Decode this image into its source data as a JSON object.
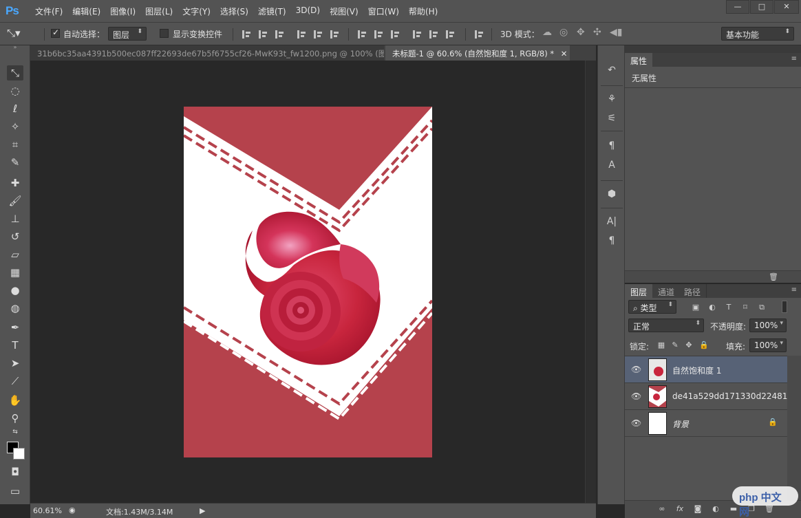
{
  "app": {
    "logo": "Ps"
  },
  "menu": [
    "文件(F)",
    "编辑(E)",
    "图像(I)",
    "图层(L)",
    "文字(Y)",
    "选择(S)",
    "滤镜(T)",
    "3D(D)",
    "视图(V)",
    "窗口(W)",
    "帮助(H)"
  ],
  "window_controls": {
    "minimize": "—",
    "maximize": "□",
    "close": "✕"
  },
  "options_bar": {
    "auto_select_label": "自动选择：",
    "auto_select_checked": true,
    "auto_select_target": "图层",
    "show_transform_label": "显示变换控件",
    "show_transform_checked": false,
    "mode_3d_label": "3D 模式：",
    "workspace": "基本功能"
  },
  "tabs": [
    {
      "label": "31b6bc35aa4391b500ec087ff22693de67b5f6755cf26-MwK93t_fw1200.png @ 100% (图...",
      "close": "✕",
      "active": false
    },
    {
      "label": "未标题-1 @ 60.6% (自然饱和度 1, RGB/8) *",
      "close": "✕",
      "active": true
    }
  ],
  "status": {
    "zoom": "60.61%",
    "doc_info": "文档:1.43M/3.14M"
  },
  "properties_panel": {
    "tab": "属性",
    "content": "无属性"
  },
  "layers_panel": {
    "tabs": [
      "图层",
      "通道",
      "路径"
    ],
    "filter_label": "类型",
    "blend_mode": "正常",
    "opacity_label": "不透明度:",
    "opacity_value": "100%",
    "lock_label": "锁定:",
    "fill_label": "填充:",
    "fill_value": "100%",
    "layers": [
      {
        "name": "自然饱和度 1",
        "selected": true,
        "locked": false
      },
      {
        "name": "de41a529dd171330d22481a...",
        "selected": false,
        "locked": false
      },
      {
        "name": "背景",
        "selected": false,
        "locked": true
      }
    ]
  },
  "colors": {
    "accent_red": "#b5424c",
    "flower": "#c8253d",
    "selected_layer": "#576276",
    "ps_logo": "#4aa8ff"
  },
  "watermark": "php 中文网"
}
